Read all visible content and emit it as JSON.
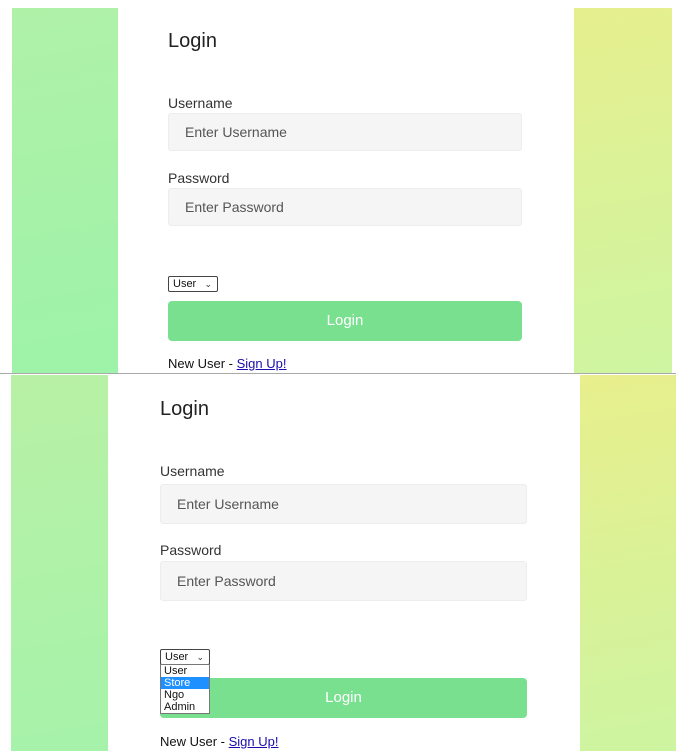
{
  "top": {
    "title": "Login",
    "username_label": "Username",
    "username_placeholder": "Enter Username",
    "password_label": "Password",
    "password_placeholder": "Enter Password",
    "role_selected": "User",
    "login_button": "Login",
    "new_user_text": "New User - ",
    "signup_link": "Sign Up!"
  },
  "bottom": {
    "title": "Login",
    "username_label": "Username",
    "username_placeholder": "Enter Username",
    "password_label": "Password",
    "password_placeholder": "Enter Password",
    "role_selected": "User",
    "role_options": [
      "User",
      "Store",
      "Ngo",
      "Admin"
    ],
    "highlighted_option": "Store",
    "login_button": "Login",
    "new_user_text": "New User - ",
    "signup_link": "Sign Up!"
  },
  "colors": {
    "button": "#79e08f",
    "link": "#1a0dab",
    "highlight": "#1e90ff"
  },
  "icons": {
    "select_chevron": "chevron-down-icon"
  }
}
